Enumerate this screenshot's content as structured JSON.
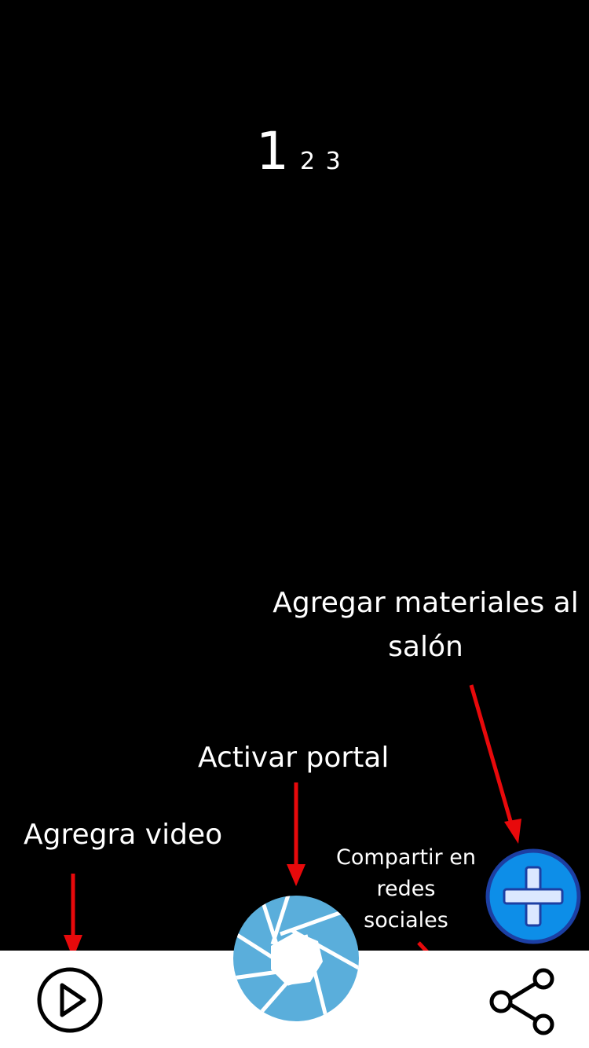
{
  "pager": {
    "current": "1",
    "others": "2 3"
  },
  "annotations": {
    "add_materials": "Agregar materiales al salón",
    "activate_portal": "Activar portal",
    "add_video": "Agregra video",
    "share_social": "Compartir en redes sociales"
  },
  "colors": {
    "background": "#000000",
    "bottom_bar": "#ffffff",
    "arrow": "#e8090b",
    "add_button": "#0d8ee8",
    "add_button_ring": "#1c3fa3",
    "portal_blue": "#5aaedb"
  },
  "icons": {
    "video": "play-circle-icon",
    "portal": "camera-aperture-icon",
    "add": "plus-icon",
    "share": "share-icon"
  }
}
